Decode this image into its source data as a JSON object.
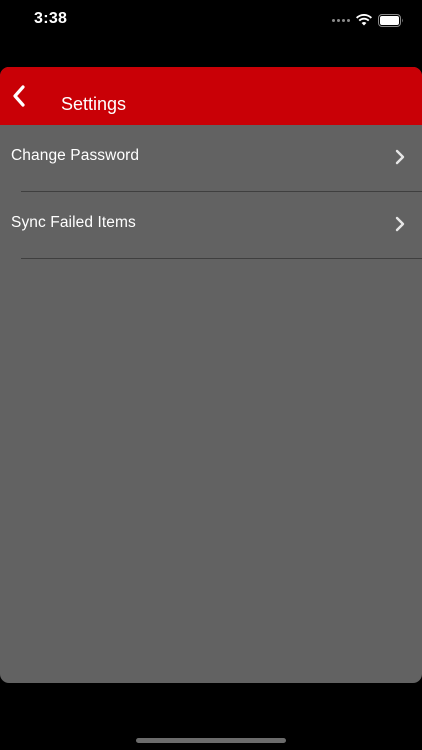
{
  "status_bar": {
    "time": "3:38",
    "icons": [
      "signal-icon",
      "wifi-icon",
      "battery-icon"
    ]
  },
  "nav": {
    "title": "Settings",
    "back_icon": "chevron-left-icon"
  },
  "settings": {
    "items": [
      {
        "label": "Change Password",
        "icon": "chevron-right-icon"
      },
      {
        "label": "Sync Failed Items",
        "icon": "chevron-right-icon"
      }
    ]
  },
  "colors": {
    "nav_background": "#c90006",
    "content_background": "#626262",
    "screen_background": "#000000",
    "text": "#ffffff",
    "divider": "#3f3f3f"
  }
}
